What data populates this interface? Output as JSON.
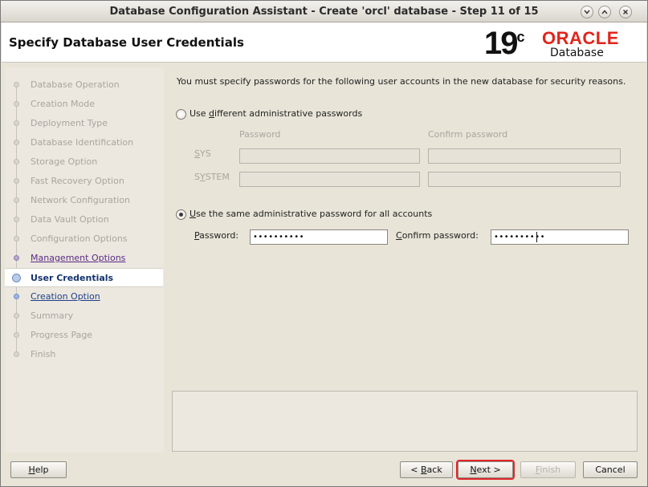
{
  "window": {
    "title": "Database Configuration Assistant - Create 'orcl' database - Step 11 of 15"
  },
  "header": {
    "page_title": "Specify Database User Credentials",
    "logo_version": "19",
    "logo_version_suffix": "c",
    "logo_brand": "ORACLE",
    "logo_product": "Database"
  },
  "nav": {
    "items": [
      {
        "label": "Database Operation",
        "state": "disabled"
      },
      {
        "label": "Creation Mode",
        "state": "disabled"
      },
      {
        "label": "Deployment Type",
        "state": "disabled"
      },
      {
        "label": "Database Identification",
        "state": "disabled"
      },
      {
        "label": "Storage Option",
        "state": "disabled"
      },
      {
        "label": "Fast Recovery Option",
        "state": "disabled"
      },
      {
        "label": "Network Configuration",
        "state": "disabled"
      },
      {
        "label": "Data Vault Option",
        "state": "disabled"
      },
      {
        "label": "Configuration Options",
        "state": "disabled"
      },
      {
        "label": "Management Options",
        "state": "visited"
      },
      {
        "label": "User Credentials",
        "state": "current"
      },
      {
        "label": "Creation Option",
        "state": "link"
      },
      {
        "label": "Summary",
        "state": "disabled"
      },
      {
        "label": "Progress Page",
        "state": "disabled"
      },
      {
        "label": "Finish",
        "state": "disabled"
      }
    ]
  },
  "content": {
    "intro": "You must specify passwords for the following user accounts in the new database for security reasons.",
    "option_different": {
      "label_pre": "Use ",
      "label_mnemonic": "d",
      "label_post": "ifferent administrative passwords",
      "selected": false
    },
    "col_password": "Password",
    "col_confirm": "Confirm password",
    "row_sys_pre": "",
    "row_sys_mnemonic": "S",
    "row_sys_post": "YS",
    "row_system_pre": "S",
    "row_system_mnemonic": "Y",
    "row_system_post": "STEM",
    "option_same": {
      "label_mnemonic": "U",
      "label_post": "se the same administrative password for all accounts",
      "selected": true
    },
    "password_label_pre": "",
    "password_label_mnemonic": "P",
    "password_label_post": "assword:",
    "password_value": "••••••••••",
    "confirm_label_mnemonic": "C",
    "confirm_label_post": "onfirm password:",
    "confirm_value": "••••••••••"
  },
  "buttons": {
    "help_mnemonic": "H",
    "help_post": "elp",
    "back_pre": "< ",
    "back_mnemonic": "B",
    "back_post": "ack",
    "next_mnemonic": "N",
    "next_post": "ext >",
    "finish_mnemonic": "F",
    "finish_post": "inish",
    "cancel": "Cancel"
  }
}
